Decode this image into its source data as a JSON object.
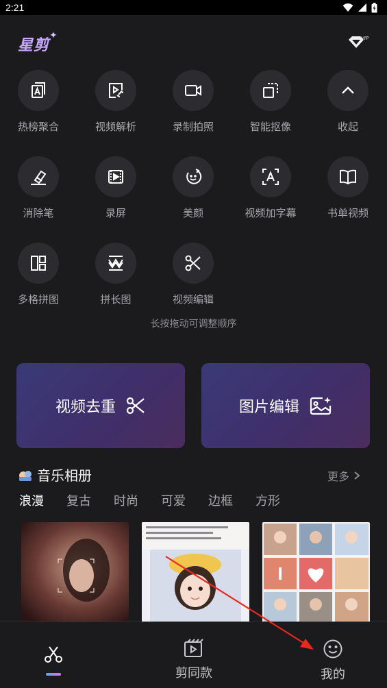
{
  "status_bar": {
    "time": "2:21"
  },
  "header": {
    "brand": "星剪",
    "vip_badge": "VIP"
  },
  "tools": [
    {
      "label": "热榜聚合",
      "icon": "trending-icon"
    },
    {
      "label": "视频解析",
      "icon": "video-link-icon"
    },
    {
      "label": "录制拍照",
      "icon": "camera-record-icon"
    },
    {
      "label": "智能抠像",
      "icon": "smart-cutout-icon"
    },
    {
      "label": "收起",
      "icon": "chevron-up-icon"
    },
    {
      "label": "消除笔",
      "icon": "eraser-icon"
    },
    {
      "label": "录屏",
      "icon": "screen-record-icon"
    },
    {
      "label": "美颜",
      "icon": "beauty-icon"
    },
    {
      "label": "视频加字幕",
      "icon": "subtitle-icon"
    },
    {
      "label": "书单视频",
      "icon": "book-icon"
    },
    {
      "label": "多格拼图",
      "icon": "grid-collage-icon"
    },
    {
      "label": "拼长图",
      "icon": "long-image-icon"
    },
    {
      "label": "视频编辑",
      "icon": "scissors-icon"
    }
  ],
  "hint": "长按拖动可调整顺序",
  "cards": {
    "dedupe": "视频去重",
    "image_edit": "图片编辑"
  },
  "music_album": {
    "title": "音乐相册",
    "more": "更多",
    "tabs": [
      "浪漫",
      "复古",
      "时尚",
      "可爱",
      "边框",
      "方形"
    ],
    "active_tab": 0
  },
  "bottom_nav": {
    "items": [
      {
        "label": "",
        "icon": "scissors-icon",
        "active": true
      },
      {
        "label": "剪同款",
        "icon": "video-template-icon",
        "active": false
      },
      {
        "label": "我的",
        "icon": "smiley-face-icon",
        "active": false
      }
    ]
  },
  "colors": {
    "background": "#1b1b1d",
    "circle": "#2c2c30",
    "accent": "#c8a9ff",
    "arrow": "#e8281e"
  }
}
